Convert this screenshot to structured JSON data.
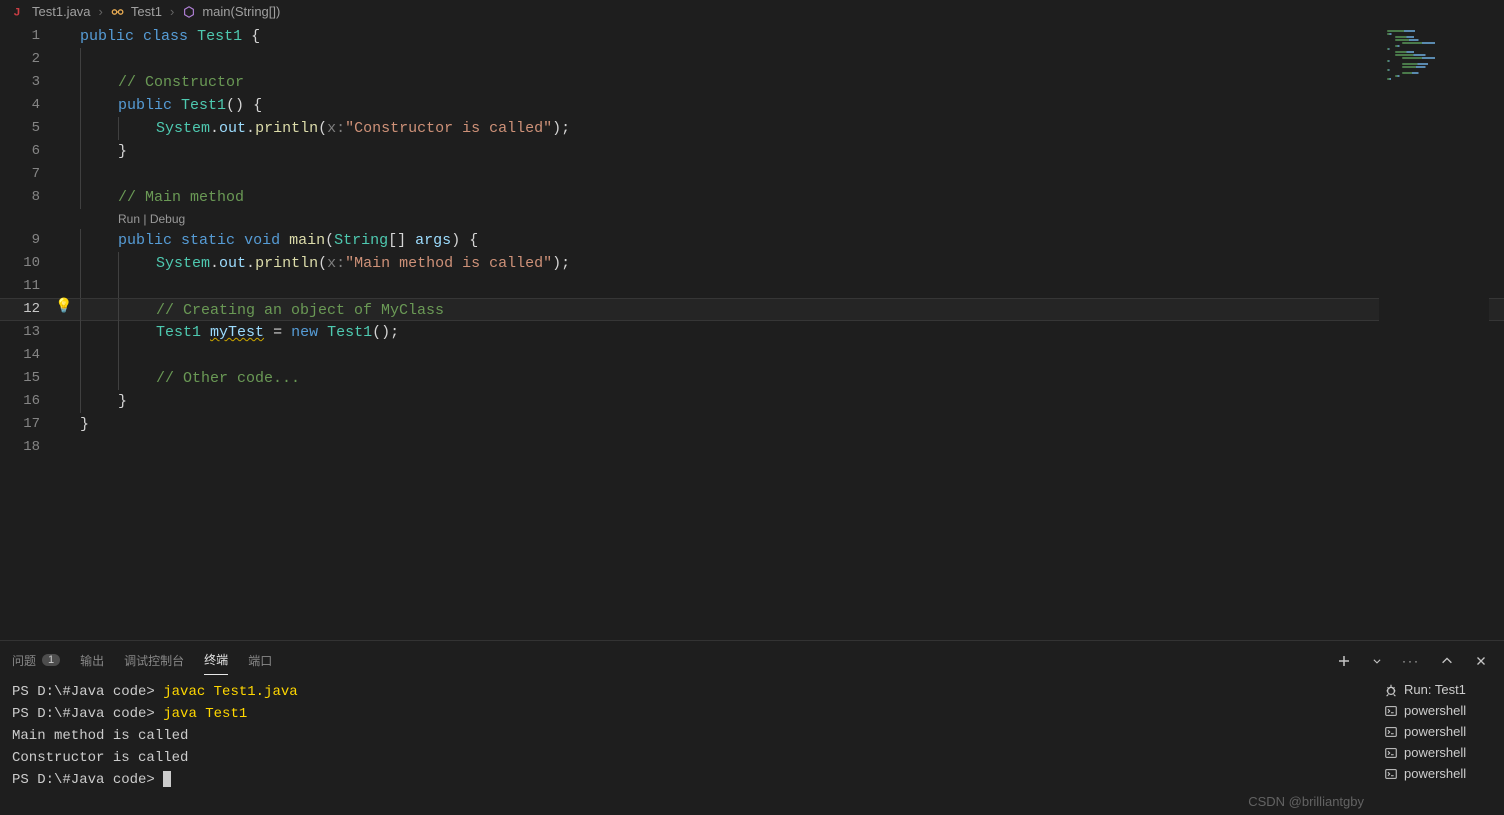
{
  "breadcrumb": {
    "file": "Test1.java",
    "class": "Test1",
    "method": "main(String[])"
  },
  "codelens": {
    "run": "Run",
    "debug": "Debug"
  },
  "lines": [
    {
      "n": 1,
      "html": "<span class='kw'>public</span> <span class='kw'>class</span> <span class='type'>Test1</span> <span class='punc'>{</span>"
    },
    {
      "n": 2,
      "html": ""
    },
    {
      "n": 3,
      "html": "    <span class='com'>// Constructor</span>"
    },
    {
      "n": 4,
      "html": "    <span class='kw'>public</span> <span class='type'>Test1</span><span class='punc'>()</span> <span class='punc'>{</span>"
    },
    {
      "n": 5,
      "html": "        <span class='type'>System</span><span class='punc'>.</span><span class='var'>out</span><span class='punc'>.</span><span class='fn'>println</span><span class='punc'>(</span><span class='param'>x:</span><span class='str'>\"Constructor is called\"</span><span class='punc'>);</span>"
    },
    {
      "n": 6,
      "html": "    <span class='punc'>}</span>"
    },
    {
      "n": 7,
      "html": ""
    },
    {
      "n": 8,
      "html": "    <span class='com'>// Main method</span>"
    },
    {
      "n": 9,
      "html": "    <span class='kw'>public</span> <span class='kw'>static</span> <span class='kw'>void</span> <span class='fn'>main</span><span class='punc'>(</span><span class='type'>String</span><span class='punc'>[]</span> <span class='var'>args</span><span class='punc'>)</span> <span class='punc'>{</span>",
      "codelens": true
    },
    {
      "n": 10,
      "html": "        <span class='type'>System</span><span class='punc'>.</span><span class='var'>out</span><span class='punc'>.</span><span class='fn'>println</span><span class='punc'>(</span><span class='param'>x:</span><span class='str'>\"Main method is called\"</span><span class='punc'>);</span>"
    },
    {
      "n": 11,
      "html": ""
    },
    {
      "n": 12,
      "html": "        <span class='com'>// Creating an object of MyClass</span>",
      "current": true,
      "bulb": true
    },
    {
      "n": 13,
      "html": "        <span class='type'>Test1</span> <span class='var squiggle'>myTest</span> <span class='punc'>=</span> <span class='kw'>new</span> <span class='type'>Test1</span><span class='punc'>();</span>"
    },
    {
      "n": 14,
      "html": ""
    },
    {
      "n": 15,
      "html": "        <span class='com'>// Other code...</span>"
    },
    {
      "n": 16,
      "html": "    <span class='punc'>}</span>"
    },
    {
      "n": 17,
      "html": "<span class='punc'>}</span>"
    },
    {
      "n": 18,
      "html": ""
    }
  ],
  "panel": {
    "tabs": {
      "problems": "问题",
      "problems_count": "1",
      "output": "输出",
      "debug": "调试控制台",
      "terminal": "终端",
      "ports": "端口"
    }
  },
  "terminal": {
    "prompt": "PS D:\\#Java code>",
    "lines": [
      {
        "type": "cmd",
        "prompt": "PS D:\\#Java code>",
        "text": "javac Test1.java"
      },
      {
        "type": "cmd",
        "prompt": "PS D:\\#Java code>",
        "text": "java Test1"
      },
      {
        "type": "out",
        "text": "Main method is called"
      },
      {
        "type": "out",
        "text": "Constructor is called"
      },
      {
        "type": "cursor",
        "prompt": "PS D:\\#Java code>"
      }
    ],
    "list": [
      {
        "icon": "bug",
        "label": "Run: Test1"
      },
      {
        "icon": "shell",
        "label": "powershell"
      },
      {
        "icon": "shell",
        "label": "powershell"
      },
      {
        "icon": "shell",
        "label": "powershell"
      },
      {
        "icon": "shell",
        "label": "powershell"
      }
    ]
  },
  "watermark": "CSDN @brilliantgby"
}
